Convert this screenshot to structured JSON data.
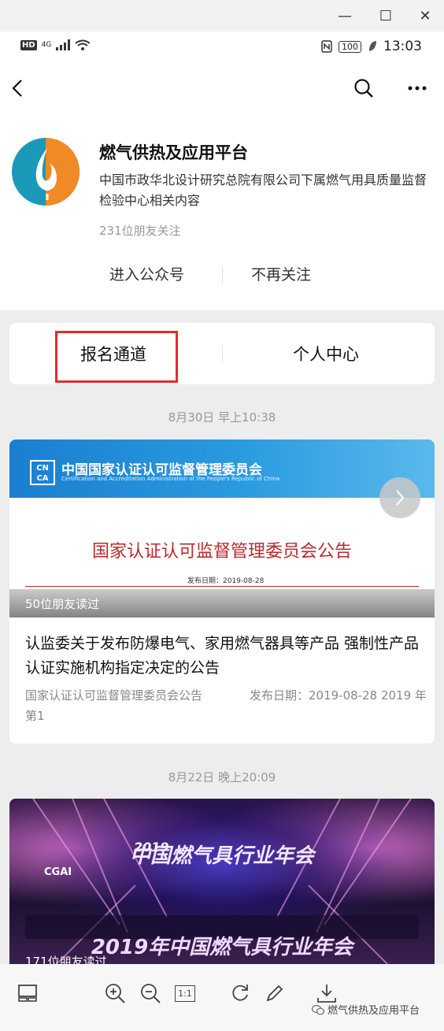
{
  "window": {
    "minimize_glyph": "—",
    "maximize_glyph": "☐",
    "close_glyph": "✕"
  },
  "status_bar": {
    "network_badge": "HD",
    "network_type": "4G",
    "battery": "100",
    "time": "13:03"
  },
  "nav": {
    "back_icon": "chevron-left-icon",
    "search_icon": "search-icon",
    "more_icon": "more-icon"
  },
  "account": {
    "name": "燃气供热及应用平台",
    "description": "中国市政华北设计研究总院有限公司下属燃气用具质量监督检验中心相关内容",
    "followers": "231位朋友关注",
    "enter_button": "进入公众号",
    "unfollow_button": "不再关注",
    "brand_colors": {
      "teal": "#1a9ab8",
      "orange": "#f08a24"
    }
  },
  "menu": {
    "items": [
      {
        "label": "报名通道",
        "highlighted": true
      },
      {
        "label": "个人中心",
        "highlighted": false
      }
    ],
    "highlight_color": "#e52b2b"
  },
  "articles": [
    {
      "timestamp": "8月30日 早上10:38",
      "cover": {
        "org_logo_text": "CN CA",
        "org_name": "中国国家认证认可监督管理委员会",
        "org_name_en": "Certification and Accreditation Administration of the People's Republic of China",
        "notice_title": "国家认证认可监督管理委员会公告",
        "notice_date": "发布日期：2019-08-28"
      },
      "read_count": "50位朋友读过",
      "title": "认监委关于发布防爆电气、家用燃气器具等产品 强制性产品认证实施机构指定决定的公告",
      "excerpt": "国家认证认可监督管理委员会公告　　　　发布日期：2019-08-28 2019 年第1"
    },
    {
      "timestamp": "8月22日 晚上20:09",
      "cover": {
        "year": "2019",
        "event_script": "中国燃气具行业年会",
        "event_title": "2019年中国燃气具行业年会",
        "org_logo_text": "CGAI"
      },
      "read_count": "171位朋友读过"
    }
  ],
  "toolbar": {
    "icons": [
      "layout-icon",
      "zoom-in-icon",
      "zoom-out-icon",
      "actual-size-icon",
      "rotate-icon",
      "edit-icon",
      "download-icon"
    ],
    "actual_size_label": "1:1",
    "watermark": "燃气供热及应用平台"
  }
}
